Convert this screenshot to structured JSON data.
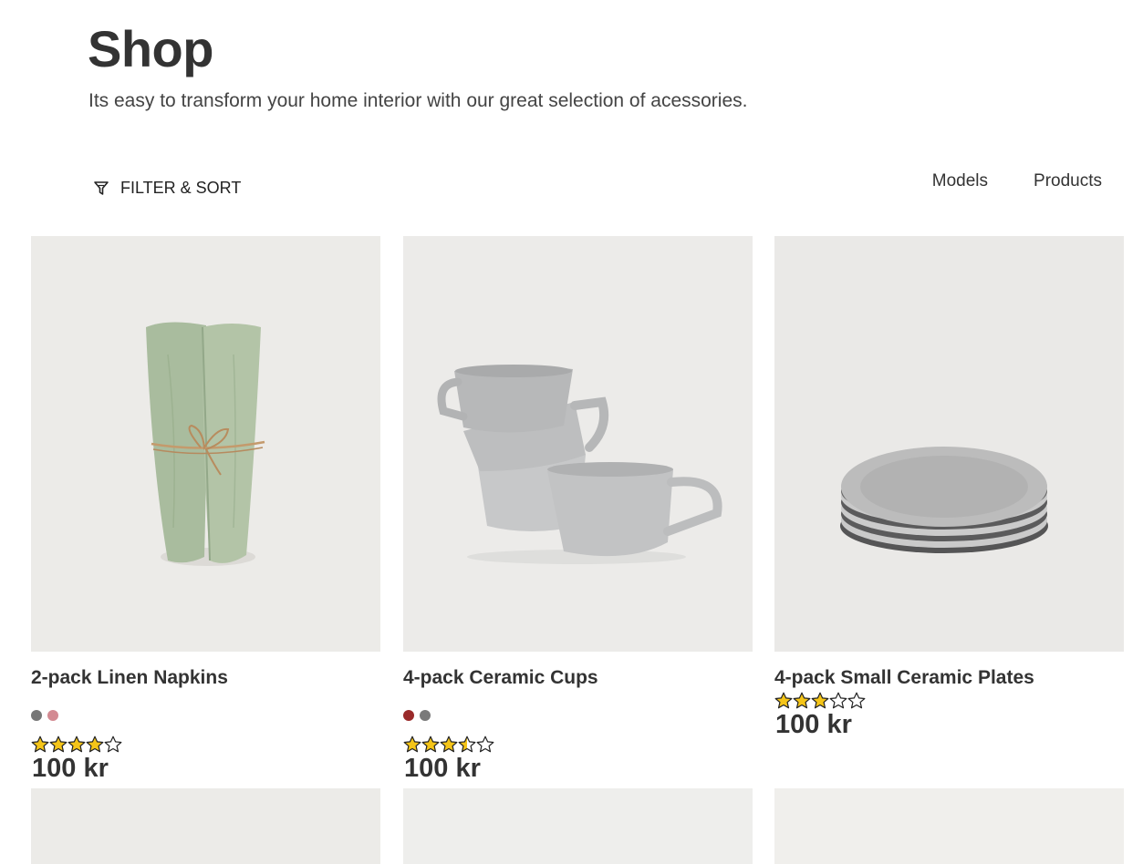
{
  "header": {
    "title": "Shop",
    "subtitle": "Its easy to transform your home interior with our great selection of acessories."
  },
  "toolbar": {
    "filter_icon": "funnel-icon",
    "filter_label": "FILTER & SORT",
    "views": [
      "Models",
      "Products"
    ]
  },
  "colors": {
    "star_fill": "#f5c518",
    "star_outline": "#222222",
    "image_bg": "#eceae8"
  },
  "products": [
    {
      "name": "2-pack Linen Napkins",
      "price": "100 kr",
      "rating": 4,
      "rating_max": 5,
      "swatches": [
        "#777777",
        "#d38a92"
      ]
    },
    {
      "name": "4-pack Ceramic Cups",
      "price": "100 kr",
      "rating": 3.5,
      "rating_max": 5,
      "swatches": [
        "#9a2a2a",
        "#7a7a7a"
      ]
    },
    {
      "name": "4-pack Small Ceramic Plates",
      "price": "100 kr",
      "rating": 3,
      "rating_max": 5,
      "swatches": []
    }
  ]
}
